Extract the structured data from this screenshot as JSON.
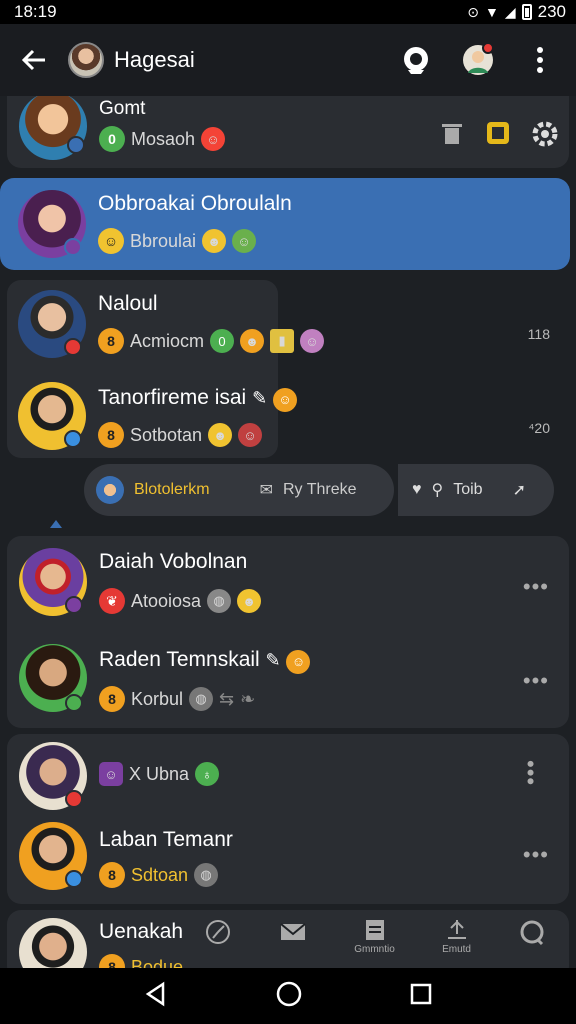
{
  "status": {
    "time": "18:19",
    "battery_text": "230"
  },
  "header": {
    "title": "Hagesai"
  },
  "colors": {
    "accent": "#3a6fb3",
    "card": "#2a2d32",
    "background": "#1d2024"
  },
  "top_item": {
    "name": "Gomt",
    "sub": "Mosaoh"
  },
  "selected_item": {
    "name": "Obbroakai Obroulaln",
    "sub": "Bbroulai"
  },
  "group1": [
    {
      "name": "Naloul",
      "sub": "Acmiocm",
      "time": "118"
    },
    {
      "name": "Tanorfireme isai",
      "sub": "Sotbotan",
      "time": "⁴20"
    }
  ],
  "chips": {
    "left_label": "Blotolerkm",
    "middle_label": "Ry Threke",
    "right_label": "Toib"
  },
  "group2": [
    {
      "name": "Daiah Vobolnan",
      "sub": "Atooiosa"
    },
    {
      "name": "Raden Temnskail",
      "sub": "Korbul"
    }
  ],
  "group3": [
    {
      "name": "",
      "sub": "X Ubna"
    },
    {
      "name": "Laban Temanr",
      "sub": "Sdtoan"
    }
  ],
  "last_item": {
    "name": "Uenakah",
    "sub": "Bodue"
  },
  "bottom_tabs": [
    {
      "icon": "compass-icon",
      "label": ""
    },
    {
      "icon": "mail-icon",
      "label": ""
    },
    {
      "icon": "notes-icon",
      "label": "Gmmntio"
    },
    {
      "icon": "upload-icon",
      "label": "Emutd"
    },
    {
      "icon": "refresh-icon",
      "label": ""
    }
  ]
}
